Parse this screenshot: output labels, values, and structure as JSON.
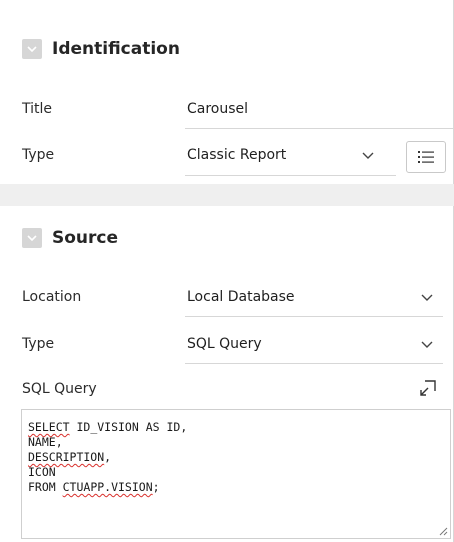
{
  "identification": {
    "title": "Identification",
    "title_label": "Title",
    "title_value": "Carousel",
    "type_label": "Type",
    "type_value": "Classic Report"
  },
  "source": {
    "title": "Source",
    "location_label": "Location",
    "location_value": "Local Database",
    "type_label": "Type",
    "type_value": "SQL Query",
    "sql_label": "SQL Query",
    "sql_lines": [
      [
        "SELECT",
        " ID_VISION AS ID,"
      ],
      [
        "",
        "NAME,"
      ],
      [
        "DESCRIPTION",
        ","
      ],
      [
        "",
        "ICON"
      ],
      [
        "FROM ",
        "CTUAPP.VISION",
        ";"
      ]
    ]
  },
  "icons": {
    "collapse": "chevron-down-icon",
    "select": "chevron-down-icon",
    "list": "list-icon",
    "expand": "expand-icon",
    "resize": "resize-handle-icon"
  },
  "colors": {
    "checkbox_bg": "#d6d6d6",
    "separator_bg": "#efefef",
    "border": "#cfcfcf",
    "spell_error": "#d9302c"
  }
}
